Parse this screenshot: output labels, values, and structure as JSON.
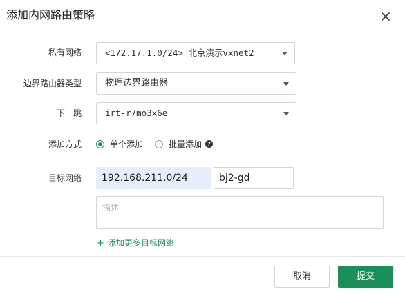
{
  "dialog": {
    "title": "添加内网路由策略",
    "close_icon": "close-icon"
  },
  "form": {
    "private_network": {
      "label": "私有网络",
      "value": "<172.17.1.0/24> 北京演示vxnet2"
    },
    "border_router_type": {
      "label": "边界路由器类型",
      "value": "物理边界路由器"
    },
    "next_hop": {
      "label": "下一跳",
      "value": "irt-r7mo3x6e"
    },
    "add_method": {
      "label": "添加方式",
      "options": [
        {
          "label": "单个添加",
          "checked": true
        },
        {
          "label": "批量添加",
          "checked": false
        }
      ],
      "help_icon": "question-circle-icon"
    },
    "target_network": {
      "label": "目标网络",
      "cidr_value": "192.168.211.0/24",
      "name_value": "bj2-gd",
      "description_placeholder": "描述",
      "add_more_label": "添加更多目标网络"
    }
  },
  "footer": {
    "cancel_label": "取消",
    "submit_label": "提交"
  },
  "colors": {
    "accent": "#1a8f5a",
    "selected_input_bg": "#e6eefb"
  }
}
